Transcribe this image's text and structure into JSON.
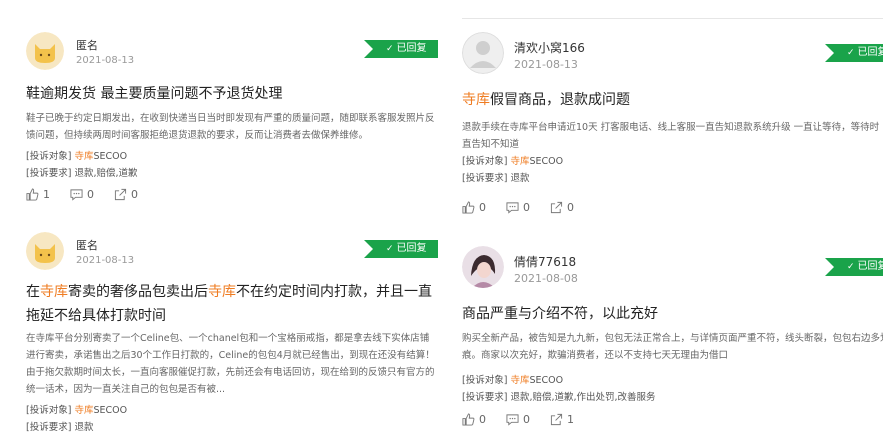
{
  "badge_label": "已回复",
  "requirement_label": "[投诉要求]",
  "target_label": "[投诉对象]",
  "cards": [
    {
      "username": "匿名",
      "date": "2021-08-13",
      "title_plain": "鞋逾期发货 最主要质量问题不予退货处理",
      "desc": "鞋子已晚于约定日期发出，在收到快递当日当时即发现有严重的质量问题，随即联系客服发照片反馈问题，但持续两周时间客服拒绝退货退款的要求，反而让消费者去做保养维修。",
      "target_hl": "寺库",
      "target_rest": "SECOO",
      "requirement": "退款,赔偿,道歉",
      "likes": "1",
      "comments": "0",
      "shares": "0"
    },
    {
      "username": "匿名",
      "date": "2021-08-13",
      "title_parts": [
        "在",
        "寺库",
        "寄卖的奢侈品包卖出后",
        "寺库",
        "不在约定时间内打款，并且一直拖延不给具体打款时间"
      ],
      "desc": "在寺库平台分别寄卖了一个Celine包、一个chanel包和一个宝格丽戒指，都是拿去线下实体店铺进行寄卖，承诺售出之后30个工作日打款的，Celine的包包4月就已经售出，到现在还没有结算！由于拖欠款期时间太长，一直向客服催促打款，先前还会有电话回访，现在给到的反馈只有官方的统一话术，因为一直关注自己的包包是否有被...",
      "target_hl": "寺库",
      "target_rest": "SECOO",
      "requirement": "退款"
    },
    {
      "username": "清欢小窝166",
      "date": "2021-08-13",
      "title_hl": "寺库",
      "title_rest": "假冒商品，退款成问题",
      "desc_l1": "退款手续在寺库平台申请近10天 打客服电话、线上客服一直告知退款系统升级 一直让等待，等待时",
      "desc_l2": "直告知不知道",
      "target_hl": "寺库",
      "target_rest": "SECOO",
      "requirement": "退款",
      "likes": "0",
      "comments": "0",
      "shares": "0"
    },
    {
      "username": "倩倩77618",
      "date": "2021-08-08",
      "title_plain": "商品严重与介绍不符，以此充好",
      "desc": "购买全新产品，被告知是九九新，包包无法正常合上，与详情页面严重不符，线头断裂，包包右边多划痕。商家以次充好，欺骗消费者，还以不支持七天无理由为借口",
      "target_hl": "寺库",
      "target_rest": "SECOO",
      "requirement": "退款,赔偿,道歉,作出处罚,改善服务",
      "likes": "0",
      "comments": "0",
      "shares": "1"
    }
  ],
  "icons": {
    "like": "thumbs-up-icon",
    "comment": "comment-icon",
    "share": "share-icon",
    "check": "check-icon"
  },
  "colors": {
    "badge_green": "#1aa34a",
    "highlight_orange": "#ef7c22"
  }
}
